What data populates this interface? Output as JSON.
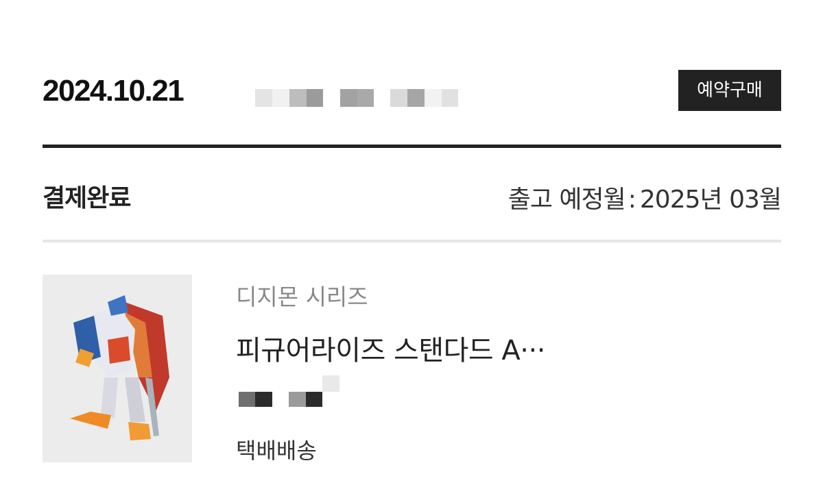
{
  "order": {
    "date": "2024.10.21",
    "badge_label": "예약구매"
  },
  "status": {
    "label": "결제완료",
    "ship_label": "출고 예정월",
    "ship_separator": ":",
    "ship_value": "2025년 03월"
  },
  "product": {
    "series": "디지몬 시리즈",
    "name": "피규어라이즈 스탠다드 A···",
    "delivery": "택배배송"
  },
  "colors": {
    "text_dark": "#222222",
    "text_gray": "#888888",
    "badge_bg": "#222222",
    "badge_text": "#ffffff",
    "divider_thick": "#222222",
    "divider_thin": "#e6e6e6",
    "thumb_bg": "#ececec"
  }
}
